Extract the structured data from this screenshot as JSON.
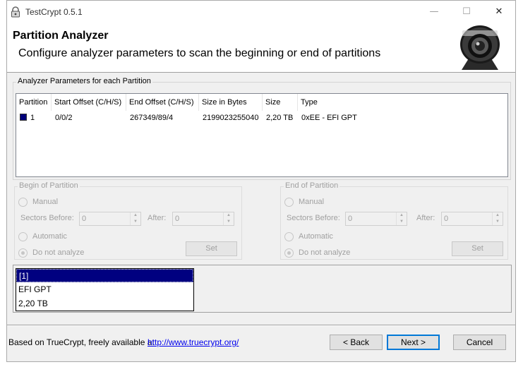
{
  "window": {
    "title": "TestCrypt 0.5.1",
    "controls": {
      "minimize": "—",
      "maximize": "☐",
      "close": "✕"
    }
  },
  "header": {
    "title": "Partition Analyzer",
    "subtitle": "Configure analyzer parameters to scan the beginning or end of partitions"
  },
  "params": {
    "group_label": "Analyzer Parameters for each Partition",
    "columns": [
      "Partition",
      "Start Offset (C/H/S)",
      "End Offset (C/H/S)",
      "Size in Bytes",
      "Size",
      "Type"
    ],
    "rows": [
      {
        "partition": "1",
        "start": "0/0/2",
        "end": "267349/89/4",
        "bytes": "2199023255040",
        "size": "2,20 TB",
        "type": "0xEE - EFI GPT",
        "color": "#00007a"
      }
    ]
  },
  "begin": {
    "label": "Begin of Partition",
    "manual": "Manual",
    "sectors_before": "Sectors Before:",
    "before_value": "0",
    "after": "After:",
    "after_value": "0",
    "automatic": "Automatic",
    "dont_analyze": "Do not analyze",
    "set": "Set",
    "selected": "dont_analyze"
  },
  "end": {
    "label": "End of Partition",
    "manual": "Manual",
    "sectors_before": "Sectors Before:",
    "before_value": "0",
    "after": "After:",
    "after_value": "0",
    "automatic": "Automatic",
    "dont_analyze": "Do not analyze",
    "set": "Set",
    "selected": "dont_analyze"
  },
  "info": {
    "lines": [
      "[1]",
      "EFI GPT",
      "2,20 TB"
    ],
    "selected_index": 0,
    "selection_color": "#000080"
  },
  "footer": {
    "text": "Based on TrueCrypt, freely available at",
    "link": "http://www.truecrypt.org/",
    "back": "< Back",
    "next": "Next >",
    "cancel": "Cancel"
  },
  "icons": {
    "app": "lock-icon",
    "logo": "webcam-lens-icon"
  }
}
